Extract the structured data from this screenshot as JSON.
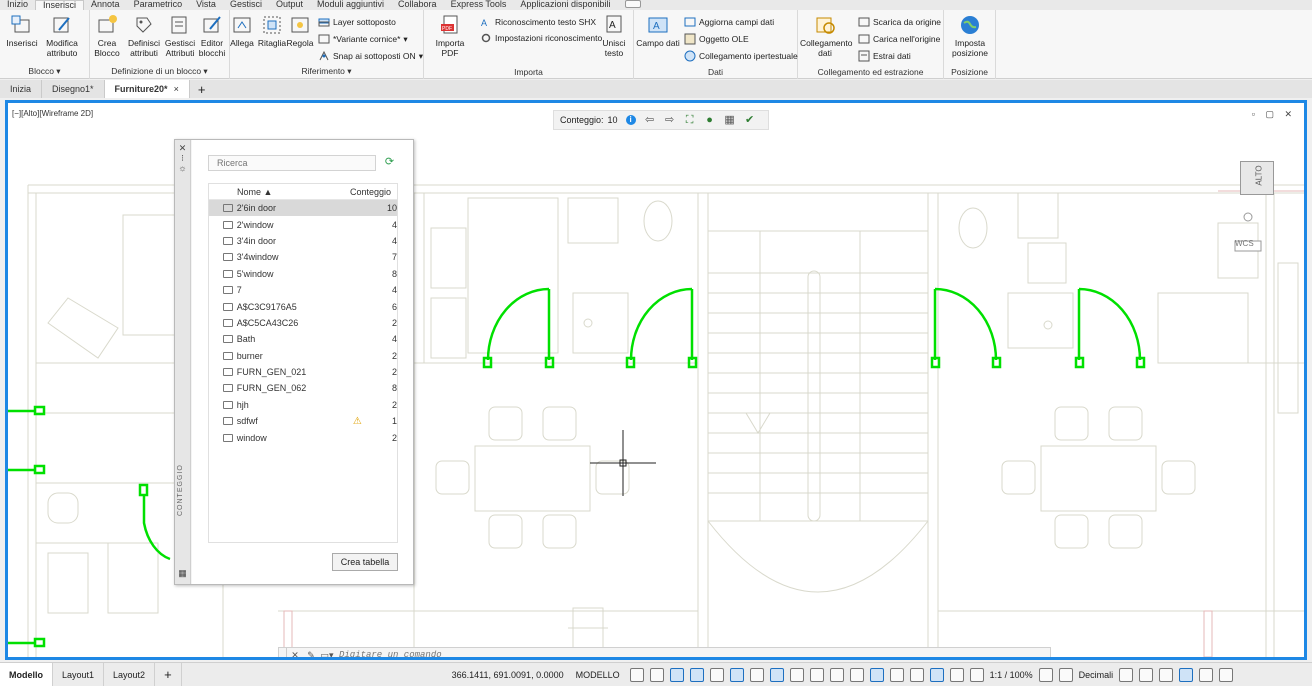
{
  "ribbon_tabs": [
    "Inizio",
    "Inserisci",
    "Annota",
    "Parametrico",
    "Vista",
    "Gestisci",
    "Output",
    "Moduli aggiuntivi",
    "Collabora",
    "Express Tools",
    "Applicazioni disponibili"
  ],
  "active_tab": "Inserisci",
  "groups": {
    "blocco": {
      "label": "Blocco ▾",
      "inserisci": "Inserisci",
      "modifica": "Modifica attributo"
    },
    "definizione": {
      "label": "Definizione di un blocco ▾",
      "crea": "Crea Blocco",
      "definisci": "Definisci attributi",
      "gestisci": "Gestisci Attributi",
      "editor": "Editor blocchi"
    },
    "riferimento": {
      "label": "Riferimento ▾",
      "allega": "Allega",
      "ritaglia": "Ritaglia",
      "regola": "Regola",
      "layer": "Layer sottoposto",
      "variante": "*Variante cornice*",
      "snap": "Snap ai sottoposti ON"
    },
    "importa": {
      "label": "Importa",
      "pdf": "Importa PDF",
      "shx": "Riconoscimento testo SHX",
      "impostazioni": "Impostazioni riconoscimento",
      "unisci": "Unisci testo"
    },
    "dati": {
      "label": "Dati",
      "campo": "Campo dati",
      "aggiorna": "Aggiorna campi dati",
      "ole": "Oggetto OLE",
      "ipertestuale": "Collegamento ipertestuale"
    },
    "collegamento": {
      "label": "Collegamento ed estrazione",
      "collegamento": "Collegamento dati",
      "scarica": "Scarica da origine",
      "carica": "Carica nell'origine",
      "estrai": "Estrai  dati"
    },
    "posizione": {
      "label": "Posizione",
      "imposta": "Imposta posizione"
    }
  },
  "file_tabs": {
    "inizia": "Inizia",
    "disegno": "Disegno1*",
    "furniture": "Furniture20*"
  },
  "view_label": "[−][Alto][Wireframe 2D]",
  "count_bar": {
    "label": "Conteggio:",
    "value": "10"
  },
  "viewcube": {
    "face": "ALTO",
    "wcs": "WCS"
  },
  "palette": {
    "title": "CONTEGGIO",
    "search_placeholder": "Ricerca",
    "col_name": "Nome ▲",
    "col_count": "Conteggio",
    "rows": [
      {
        "name": "2'6in door",
        "count": "10",
        "selected": true
      },
      {
        "name": "2'window",
        "count": "4"
      },
      {
        "name": "3'4in door",
        "count": "4"
      },
      {
        "name": "3'4window",
        "count": "7"
      },
      {
        "name": "5'window",
        "count": "8"
      },
      {
        "name": "7",
        "count": "4"
      },
      {
        "name": "A$C3C9176A5",
        "count": "6"
      },
      {
        "name": "A$C5CA43C26",
        "count": "2"
      },
      {
        "name": "Bath",
        "count": "4"
      },
      {
        "name": "burner",
        "count": "2"
      },
      {
        "name": "FURN_GEN_021",
        "count": "2"
      },
      {
        "name": "FURN_GEN_062",
        "count": "8"
      },
      {
        "name": "hjh",
        "count": "2"
      },
      {
        "name": "sdfwf",
        "count": "1",
        "warning": true
      },
      {
        "name": "window",
        "count": "2"
      }
    ],
    "create_table": "Crea tabella"
  },
  "command": {
    "placeholder": "Digitare un comando"
  },
  "status": {
    "layouts": [
      "Modello",
      "Layout1",
      "Layout2"
    ],
    "coords": "366.1411, 691.0091, 0.0000",
    "mode": "MODELLO",
    "scale": "1:1 / 100%",
    "units": "Decimali"
  },
  "colors": {
    "accent": "#1e88e5",
    "highlight": "#00e000",
    "plan_line": "#d7d7c7"
  }
}
